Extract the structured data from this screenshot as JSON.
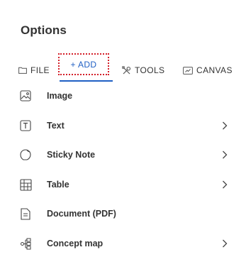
{
  "title": "Options",
  "tabs": [
    {
      "label": "FILE",
      "icon": "folder-icon"
    },
    {
      "label": "+ ADD",
      "icon": "plus-icon"
    },
    {
      "label": "TOOLS",
      "icon": "tools-icon"
    },
    {
      "label": "CANVAS",
      "icon": "canvas-icon"
    }
  ],
  "menu": [
    {
      "label": "Image",
      "icon": "image-icon",
      "has_submenu": false
    },
    {
      "label": "Text",
      "icon": "text-icon",
      "has_submenu": true
    },
    {
      "label": "Sticky Note",
      "icon": "sticky-note-icon",
      "has_submenu": true
    },
    {
      "label": "Table",
      "icon": "table-icon",
      "has_submenu": true
    },
    {
      "label": "Document (PDF)",
      "icon": "document-icon",
      "has_submenu": false
    },
    {
      "label": "Concept map",
      "icon": "concept-map-icon",
      "has_submenu": true
    }
  ],
  "colors": {
    "accent": "#1f5fc4",
    "focus_outline": "#d4202a",
    "text": "#333333"
  }
}
